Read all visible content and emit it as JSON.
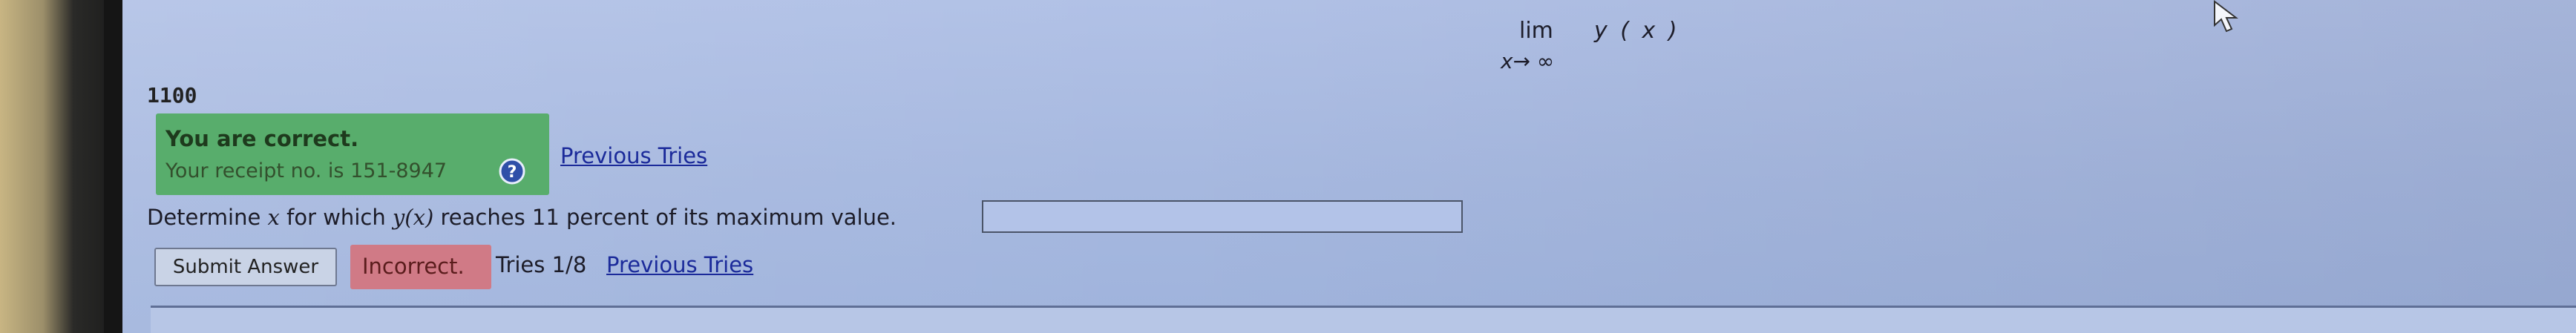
{
  "math": {
    "lim_word": "lim",
    "lim_subscript": "x→ ∞",
    "function_expr": "y ( x )"
  },
  "previous_part": {
    "answer": "1100",
    "status_title": "You are correct.",
    "receipt_text": "Your receipt no. is 151-8947",
    "help_icon": "help-icon",
    "previous_tries_link": "Previous Tries"
  },
  "question": {
    "prefix": "Determine ",
    "var_x": "x",
    "middle": " for which ",
    "fn": "y(x)",
    "suffix": " reaches 11 percent of its maximum value.",
    "answer_value": "",
    "answer_placeholder": ""
  },
  "controls": {
    "submit_label": "Submit Answer",
    "status_badge": "Incorrect.",
    "tries_text": "Tries 1/8",
    "previous_tries_link": "Previous Tries"
  },
  "colors": {
    "correct_bg": "#58ad6c",
    "incorrect_bg": "#d07a86",
    "link": "#1b2a9a",
    "page_bg": "#a9bbe0"
  }
}
